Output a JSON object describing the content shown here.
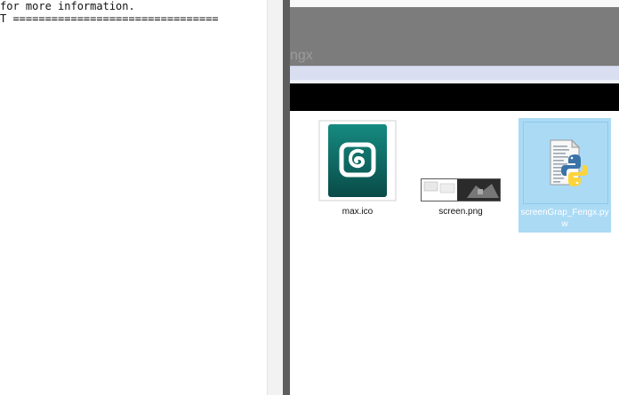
{
  "shell": {
    "lines": [
      "for more information.",
      "T ================================"
    ]
  },
  "explorer": {
    "title_fragment": "ngx",
    "files": [
      {
        "name": "max.ico",
        "icon": "3ds-max-icon",
        "selected": false
      },
      {
        "name": "screen.png",
        "icon": "screenshot-thumbnail",
        "selected": false
      },
      {
        "name_line1": "screenGrap_Fengx.py",
        "name_line2": "w",
        "icon": "python-script-icon",
        "selected": true
      }
    ]
  },
  "colors": {
    "selection": "#abdaf5",
    "max_icon": "#0f6b66",
    "python_blue": "#3a73a8",
    "python_yellow": "#ffd43b"
  }
}
